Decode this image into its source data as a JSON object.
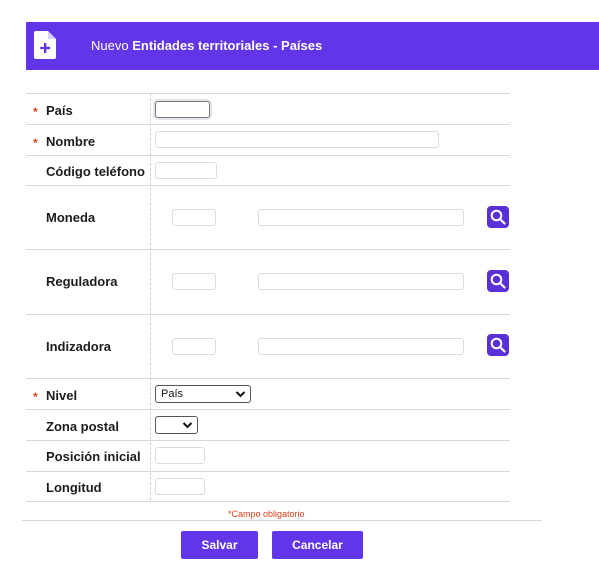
{
  "header": {
    "prefix": "Nuevo",
    "title": "Entidades territoriales - Países",
    "icon": "new-document-icon"
  },
  "fields": {
    "pais": {
      "label": "País",
      "required": true,
      "value": ""
    },
    "nombre": {
      "label": "Nombre",
      "required": true,
      "value": ""
    },
    "codigo_telefono": {
      "label": "Código teléfono",
      "value": ""
    },
    "moneda": {
      "label": "Moneda",
      "code": "",
      "description": ""
    },
    "reguladora": {
      "label": "Reguladora",
      "code": "",
      "description": ""
    },
    "indizadora": {
      "label": "Indizadora",
      "code": "",
      "description": ""
    },
    "nivel": {
      "label": "Nivel",
      "required": true,
      "selected": "País"
    },
    "zona_postal": {
      "label": "Zona postal",
      "selected": ""
    },
    "posicion_inicial": {
      "label": "Posición inicial",
      "value": ""
    },
    "longitud": {
      "label": "Longitud",
      "value": ""
    }
  },
  "required_marker": "*",
  "required_note": "*Campo obligatorio",
  "buttons": {
    "save": "Salvar",
    "cancel": "Cancelar"
  },
  "colors": {
    "accent": "#6236e8",
    "required": "#e0411a"
  }
}
